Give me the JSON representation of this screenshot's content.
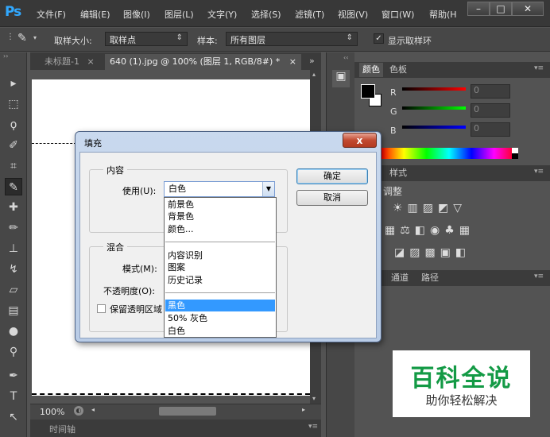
{
  "app": {
    "logo": "Ps"
  },
  "menu": [
    "文件(F)",
    "编辑(E)",
    "图像(I)",
    "图层(L)",
    "文字(Y)",
    "选择(S)",
    "滤镜(T)",
    "视图(V)",
    "窗口(W)",
    "帮助(H"
  ],
  "window_controls": {
    "minimize": "–",
    "maximize": "□",
    "close": "✕"
  },
  "options_bar": {
    "sample_size_label": "取样大小:",
    "sample_size_value": "取样点",
    "sample_label": "样本:",
    "sample_value": "所有图层",
    "show_ring_label": "显示取样环",
    "show_ring_checked": true
  },
  "doc_tabs": [
    {
      "label": "未标题-1",
      "close": "×",
      "active": false
    },
    {
      "label": "640 (1).jpg @ 100% (图层 1, RGB/8#) *",
      "close": "×",
      "active": true
    }
  ],
  "doc_tabs_overflow": "»",
  "status": {
    "zoom": "100%"
  },
  "timeline_label": "时间轴",
  "panels": {
    "color_tabs": [
      "颜色",
      "色板"
    ],
    "channels": [
      {
        "label": "R",
        "value": "0",
        "color": "#ff0000"
      },
      {
        "label": "G",
        "value": "0",
        "color": "#00ff00"
      },
      {
        "label": "B",
        "value": "0",
        "color": "#0000ff"
      }
    ],
    "adjust_tabs": [
      "样式"
    ],
    "adjust_title": "调整",
    "layer_tabs": [
      "通道",
      "路径"
    ]
  },
  "watermark": {
    "title": "百科全说",
    "subtitle": "助你轻松解决",
    "title_color": "#139a45"
  },
  "dialog": {
    "title": "填充",
    "close": "x",
    "contents_group": "内容",
    "use_label": "使用(U):",
    "use_value": "白色",
    "blend_group": "混合",
    "mode_label": "模式(M):",
    "opacity_label": "不透明度(O):",
    "preserve_label": "保留透明区域",
    "ok": "确定",
    "cancel": "取消"
  },
  "dropdown": {
    "items": [
      {
        "label": "前景色",
        "selected": false
      },
      {
        "label": "背景色",
        "selected": false
      },
      {
        "label": "颜色...",
        "selected": false
      },
      {
        "label": "内容识别",
        "selected": false
      },
      {
        "label": "图案",
        "selected": false
      },
      {
        "label": "历史记录",
        "selected": false
      },
      {
        "label": "黑色",
        "selected": true
      },
      {
        "label": "50% 灰色",
        "selected": false
      },
      {
        "label": "白色",
        "selected": false
      }
    ]
  }
}
